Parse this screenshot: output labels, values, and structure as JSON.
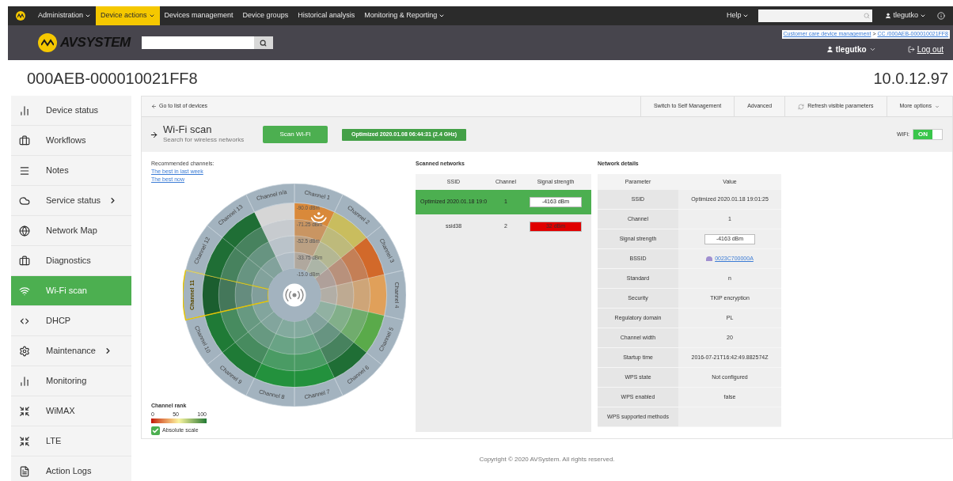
{
  "top_nav": {
    "items": [
      {
        "label": "Administration",
        "dropdown": true,
        "selected": false
      },
      {
        "label": "Device actions",
        "dropdown": true,
        "selected": true
      },
      {
        "label": "Devices management",
        "dropdown": false,
        "selected": false
      },
      {
        "label": "Device groups",
        "dropdown": false,
        "selected": false
      },
      {
        "label": "Historical analysis",
        "dropdown": false,
        "selected": false
      },
      {
        "label": "Monitoring & Reporting",
        "dropdown": true,
        "selected": false
      }
    ],
    "help": "Help",
    "user": "tlegutko"
  },
  "header": {
    "logo": "AVSYSTEM",
    "breadcrumb": [
      "Customer care device management",
      "CC /000AEB-000010021FF8"
    ],
    "breadcrumb_separator": ">",
    "user": "tlegutko",
    "logout": "Log out"
  },
  "device": {
    "id": "000AEB-000010021FF8",
    "ip": "10.0.12.97"
  },
  "sidebar": {
    "items": [
      {
        "label": "Device status",
        "submenu": false,
        "selected": false
      },
      {
        "label": "Workflows",
        "submenu": false,
        "selected": false
      },
      {
        "label": "Notes",
        "submenu": false,
        "selected": false
      },
      {
        "label": "Service status",
        "submenu": true,
        "selected": false
      },
      {
        "label": "Network Map",
        "submenu": false,
        "selected": false
      },
      {
        "label": "Diagnostics",
        "submenu": false,
        "selected": false
      },
      {
        "label": "Wi-Fi scan",
        "submenu": false,
        "selected": true
      },
      {
        "label": "DHCP",
        "submenu": false,
        "selected": false
      },
      {
        "label": "Maintenance",
        "submenu": true,
        "selected": false
      },
      {
        "label": "Monitoring",
        "submenu": false,
        "selected": false
      },
      {
        "label": "WiMAX",
        "submenu": false,
        "selected": false
      },
      {
        "label": "LTE",
        "submenu": false,
        "selected": false
      },
      {
        "label": "Action Logs",
        "submenu": false,
        "selected": false
      }
    ]
  },
  "toolbar": {
    "back": "Go to list of devices",
    "actions": [
      "Switch to Self Management",
      "Advanced",
      "Refresh visible parameters",
      "More options"
    ]
  },
  "page": {
    "title": "Wi-Fi scan",
    "subtitle": "Search for wireless networks",
    "scan_button": "Scan Wi-Fi",
    "status": "Optimized 2020.01.08 06:44:31 (2.4 GHz)",
    "wifi_label": "WiFi:",
    "wifi_on": true,
    "wifi_state": "ON"
  },
  "recommended": {
    "title": "Recommended channels:",
    "links": [
      "The best in last week",
      "The best now"
    ]
  },
  "wheel": {
    "ring_labels": [
      "-90.0 dBm",
      "-71.25 dBm",
      "-52.5 dBm",
      "-33.75 dBm",
      "-15.0 dBm"
    ],
    "channels": [
      {
        "label": "Channel 1",
        "color": "#d9893a",
        "selected": false
      },
      {
        "label": "Channel 2",
        "color": "#c9bd5e",
        "selected": false
      },
      {
        "label": "Channel 3",
        "color": "#d2692a",
        "selected": false
      },
      {
        "label": "Channel 4",
        "color": "#e0a05a",
        "selected": false
      },
      {
        "label": "Channel 5",
        "color": "#5aaa4a",
        "selected": false
      },
      {
        "label": "Channel 6",
        "color": "#1f6e35",
        "selected": false
      },
      {
        "label": "Channel 7",
        "color": "#23913d",
        "selected": false
      },
      {
        "label": "Channel 8",
        "color": "#23913d",
        "selected": false
      },
      {
        "label": "Channel 9",
        "color": "#1f7a36",
        "selected": false
      },
      {
        "label": "Channel 10",
        "color": "#1f7a36",
        "selected": false
      },
      {
        "label": "Channel 11",
        "color": "#1b5e2f",
        "selected": true
      },
      {
        "label": "Channel 12",
        "color": "#1f6e35",
        "selected": false
      },
      {
        "label": "Channel 13",
        "color": "#1f6e35",
        "selected": false
      },
      {
        "label": "Channel n/a",
        "color": "#d6d6d6",
        "selected": false
      }
    ]
  },
  "legend": {
    "title": "Channel rank",
    "ticks": [
      "0",
      "50",
      "100"
    ],
    "absolute_scale": {
      "label": "Absolute scale",
      "checked": true
    }
  },
  "scanned": {
    "title": "Scanned networks",
    "columns": [
      "SSID",
      "Channel",
      "Signal strength"
    ],
    "rows": [
      {
        "ssid": "Optimized 2020.01.18 19:0",
        "channel": "1",
        "strength": "-4163 dBm",
        "color": "#ffffff",
        "selected": true
      },
      {
        "ssid": "ssid38",
        "channel": "2",
        "strength": "32 dBm",
        "color": "#e00000",
        "selected": false
      }
    ]
  },
  "details": {
    "title": "Network details",
    "columns": [
      "Parameter",
      "Value"
    ],
    "rows": [
      {
        "parameter": "SSID",
        "kind": "text",
        "value": "Optimized 2020.01.18 19:01:25"
      },
      {
        "parameter": "Channel",
        "kind": "text",
        "value": "1"
      },
      {
        "parameter": "Signal strength",
        "kind": "box",
        "value": "-4163 dBm"
      },
      {
        "parameter": "BSSID",
        "kind": "link",
        "value": "0023C700000A"
      },
      {
        "parameter": "Standard",
        "kind": "text",
        "value": "n"
      },
      {
        "parameter": "Security",
        "kind": "text",
        "value": "TKIP encryption"
      },
      {
        "parameter": "Regulatory domain",
        "kind": "text",
        "value": "PL"
      },
      {
        "parameter": "Channel width",
        "kind": "text",
        "value": "20"
      },
      {
        "parameter": "Startup time",
        "kind": "text",
        "value": "2016-07-21T16:42:49.882574Z"
      },
      {
        "parameter": "WPS state",
        "kind": "text",
        "value": "Not configured"
      },
      {
        "parameter": "WPS enabled",
        "kind": "text",
        "value": "false"
      },
      {
        "parameter": "WPS supported methods",
        "kind": "empty"
      }
    ]
  },
  "footer": "Copyright © 2020 AVSystem. All rights reserved."
}
